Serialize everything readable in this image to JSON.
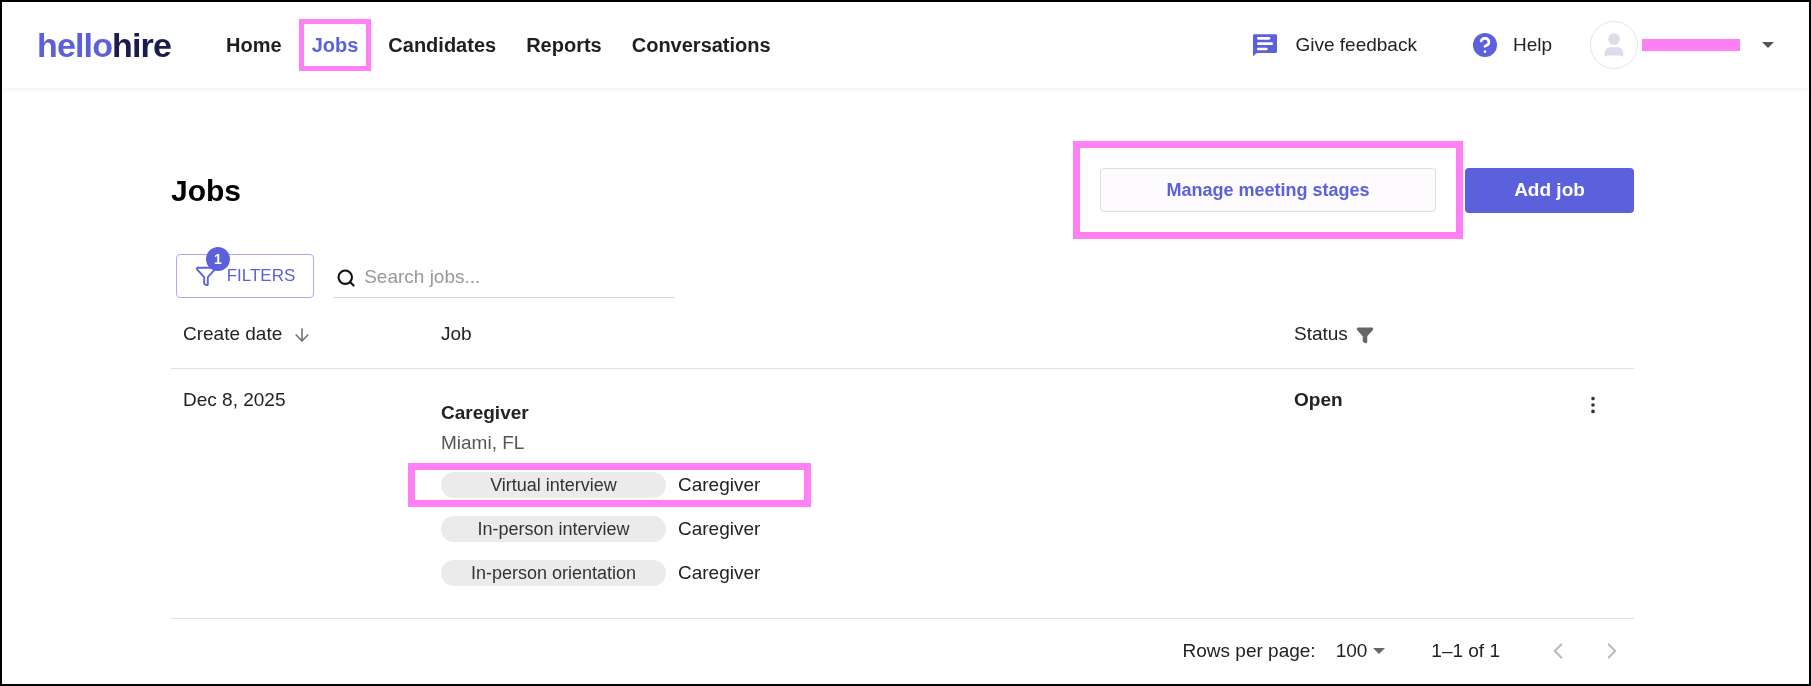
{
  "header": {
    "logo": {
      "part_1": "hello",
      "part_2": "hire"
    },
    "nav": [
      {
        "label": "Home",
        "selected": false,
        "highlighted": false
      },
      {
        "label": "Jobs",
        "selected": true,
        "highlighted": true
      },
      {
        "label": "Candidates",
        "selected": false,
        "highlighted": false
      },
      {
        "label": "Reports",
        "selected": false,
        "highlighted": false
      },
      {
        "label": "Conversations",
        "selected": false,
        "highlighted": false
      }
    ],
    "feedback": "Give feedback",
    "help": "Help",
    "user": {
      "name_redacted": true
    }
  },
  "page": {
    "title": "Jobs",
    "manage_button": {
      "label": "Manage meeting stages",
      "highlighted": true
    },
    "add_button": "Add job"
  },
  "toolbar": {
    "filters": {
      "label": "FILTERS",
      "count": "1"
    },
    "search": {
      "placeholder": "Search jobs..."
    }
  },
  "table": {
    "columns": [
      "Create date",
      "Job",
      "Status"
    ],
    "rows": [
      {
        "date": "Dec 8, 2025",
        "title": "Caregiver",
        "location": "Miami, FL",
        "status": "Open",
        "stages": [
          {
            "stage": "Virtual interview",
            "role": "Caregiver",
            "highlighted": true
          },
          {
            "stage": "In-person interview",
            "role": "Caregiver",
            "highlighted": false
          },
          {
            "stage": "In-person orientation",
            "role": "Caregiver",
            "highlighted": false
          }
        ]
      }
    ]
  },
  "pagination": {
    "rows_per_page_label": "Rows per page:",
    "rows_per_page": "100",
    "range": "1–1 of 1",
    "prev_disabled": true,
    "next_disabled": true
  }
}
